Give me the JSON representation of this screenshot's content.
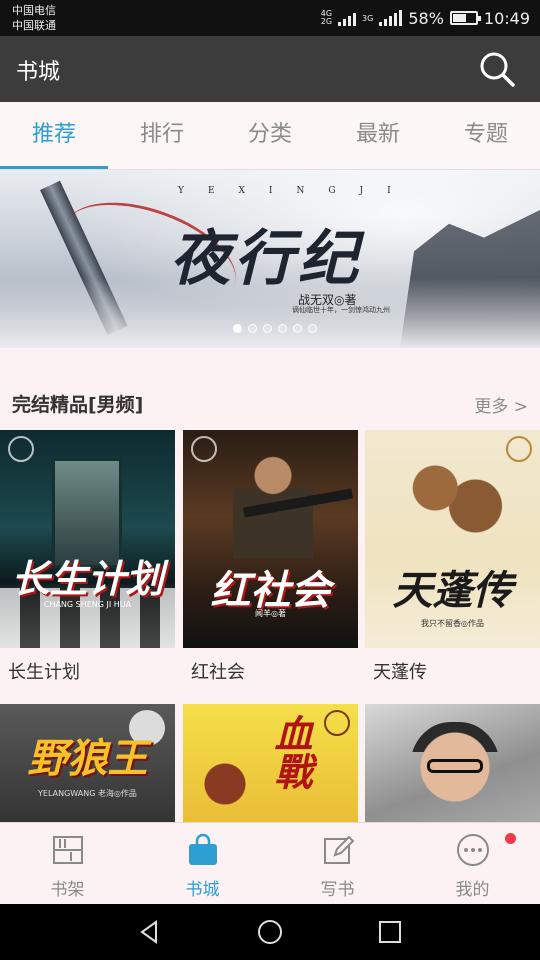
{
  "status_bar": {
    "carrier_1": "中国电信",
    "carrier_2": "中国联通",
    "net_1": "4G",
    "net_2": "2G",
    "net_3": "3G",
    "battery_percent": "58%",
    "battery_level": 0.58,
    "time": "10:49"
  },
  "app_bar": {
    "title": "书城",
    "search_icon": "search-icon"
  },
  "tabs": [
    {
      "label": "推荐",
      "active": true
    },
    {
      "label": "排行",
      "active": false
    },
    {
      "label": "分类",
      "active": false
    },
    {
      "label": "最新",
      "active": false
    },
    {
      "label": "专题",
      "active": false
    }
  ],
  "banner": {
    "spelled": "YEXINGJI",
    "title": "夜行纪",
    "author": "战无双◎著",
    "tagline": "谪仙临世十年，一剑惊鸿动九州",
    "page_count": 6,
    "active_page": 0
  },
  "section": {
    "title": "完结精品[男频]",
    "more": "更多 >"
  },
  "books": [
    {
      "title": "长生计划",
      "cover_text": "长生计划",
      "cover_sub": "CHANG SHENG JI HUA"
    },
    {
      "title": "红社会",
      "cover_text": "红社会",
      "cover_sub": "闻羊◎著"
    },
    {
      "title": "天蓬传",
      "cover_text": "天蓬传",
      "cover_sub": "我只不留香◎作品"
    },
    {
      "title": "",
      "cover_text": "野狼王",
      "cover_sub": "YELANGWANG  老海◎作品"
    },
    {
      "title": "",
      "cover_text": "血戰",
      "cover_sub": ""
    },
    {
      "title": "",
      "cover_text": "",
      "cover_sub": ""
    }
  ],
  "bottom_nav": [
    {
      "label": "书架",
      "icon": "bookshelf-icon",
      "active": false
    },
    {
      "label": "书城",
      "icon": "bookstore-bag-icon",
      "active": true
    },
    {
      "label": "写书",
      "icon": "write-edit-icon",
      "active": false
    },
    {
      "label": "我的",
      "icon": "profile-chat-icon",
      "active": false,
      "badge": true
    }
  ],
  "colors": {
    "accent": "#2e9fd3",
    "app_bar": "#3c3c3c",
    "background": "#fdf2f3",
    "badge": "#ef3c4a"
  }
}
